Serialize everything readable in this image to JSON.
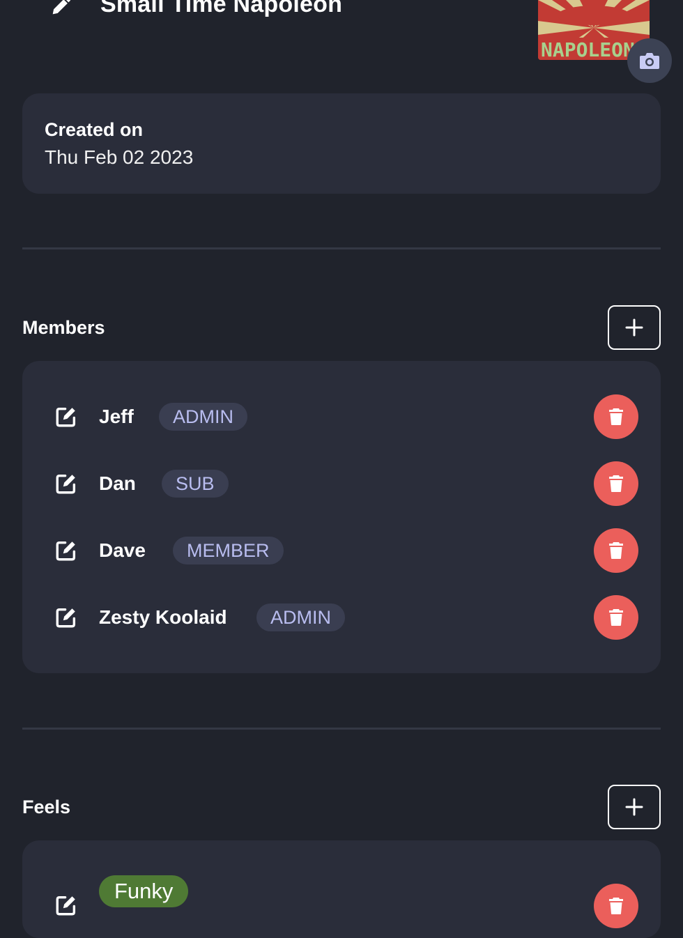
{
  "header": {
    "title": "Small Time Napoleon",
    "logo_text": "NAPOLEON"
  },
  "created": {
    "label": "Created on",
    "date": "Thu Feb 02 2023"
  },
  "members": {
    "title": "Members",
    "items": [
      {
        "name": "Jeff",
        "role": "ADMIN"
      },
      {
        "name": "Dan",
        "role": "SUB"
      },
      {
        "name": "Dave",
        "role": "MEMBER"
      },
      {
        "name": "Zesty Koolaid",
        "role": "ADMIN"
      }
    ]
  },
  "feels": {
    "title": "Feels",
    "items": [
      {
        "name": "Funky",
        "color": "#4f7a34"
      }
    ]
  },
  "colors": {
    "background": "#20232c",
    "card": "#2a2d3a",
    "delete": "#eb5f5b",
    "badge_bg": "#3a3e51",
    "badge_text": "#b9bdf0"
  },
  "icons": {
    "title_edit": "pencil-icon",
    "camera": "camera-icon",
    "add": "plus-icon",
    "row_edit": "edit-square-icon",
    "delete": "trash-icon"
  }
}
